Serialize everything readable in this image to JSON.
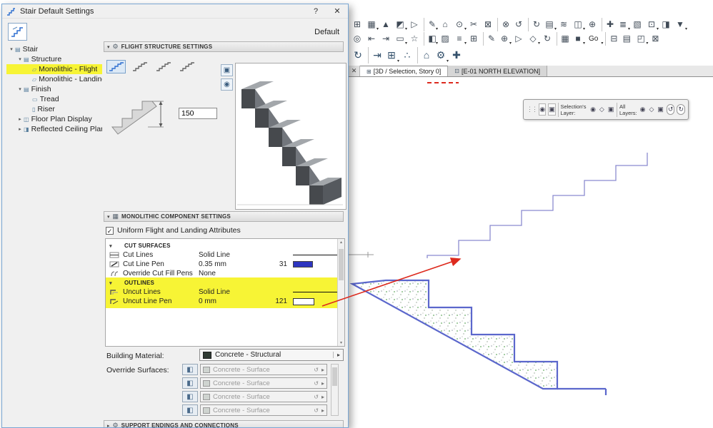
{
  "window": {
    "title": "Stair Default Settings",
    "help_label": "?",
    "close_label": "✕",
    "default_label": "Default"
  },
  "icons": {
    "collapse": "▾",
    "expand": "▸",
    "caret": "▾",
    "check": "✓",
    "display_btn": "▣",
    "orbit_btn": "◉",
    "tab_grid": "⊞",
    "tab_close": "✕",
    "surface_btn": "◧",
    "reset_mini": "↺",
    "dd_arrow": "▸"
  },
  "sidebar": {
    "items": [
      {
        "label": "Stair",
        "arrow": "▾",
        "icon": "▤",
        "indent": 0
      },
      {
        "label": "Structure",
        "arrow": "▾",
        "icon": "▤",
        "indent": 1
      },
      {
        "label": "Monolithic - Flight",
        "arrow": "",
        "icon": "▱",
        "indent": 2,
        "highlight": true
      },
      {
        "label": "Monolithic - Landing",
        "arrow": "",
        "icon": "▱",
        "indent": 2
      },
      {
        "label": "Finish",
        "arrow": "▾",
        "icon": "▤",
        "indent": 1
      },
      {
        "label": "Tread",
        "arrow": "",
        "icon": "▭",
        "indent": 2
      },
      {
        "label": "Riser",
        "arrow": "",
        "icon": "▯",
        "indent": 2
      },
      {
        "label": "Floor Plan Display",
        "arrow": "▸",
        "icon": "◫",
        "indent": 1
      },
      {
        "label": "Reflected Ceiling Plan",
        "arrow": "▸",
        "icon": "◨",
        "indent": 1
      }
    ]
  },
  "flight": {
    "title": "FLIGHT STRUCTURE SETTINGS",
    "input_value": "150",
    "types": [
      {
        "sel": true
      },
      {},
      {},
      {}
    ]
  },
  "mono": {
    "title": "MONOLITHIC COMPONENT SETTINGS",
    "uniform_checkbox": "Uniform Flight and Landing Attributes",
    "cut_header": "CUT SURFACES",
    "cut_rows": [
      {
        "label": "Cut Lines",
        "value": "Solid Line"
      },
      {
        "label": "Cut Line Pen",
        "value": "0.35 mm",
        "pen": "31"
      },
      {
        "label": "Override Cut Fill Pens",
        "value": "None"
      }
    ],
    "outlines_header": "OUTLINES",
    "outline_rows": [
      {
        "label": "Uncut Lines",
        "value": "Solid Line"
      },
      {
        "label": "Uncut Line Pen",
        "value": "0 mm",
        "pen": "121"
      }
    ]
  },
  "material": {
    "label": "Building Material:",
    "value": "Concrete - Structural"
  },
  "surfaces": {
    "label": "Override Surfaces:",
    "rows": [
      "Concrete - Surface",
      "Concrete - Surface",
      "Concrete - Surface",
      "Concrete - Surface"
    ]
  },
  "support": {
    "title": "SUPPORT ENDINGS AND CONNECTIONS"
  },
  "tabs": [
    {
      "icon": "⊞",
      "label": "[3D / Selection, Story 0]",
      "active": true
    },
    {
      "icon": "⊡",
      "label": "[E-01 NORTH ELEVATION]"
    }
  ],
  "layers": {
    "selection_label": "Selection's Layer:",
    "all_label": "All Layers:",
    "eye": "◉",
    "fill": "◇",
    "lock": "▣",
    "undo": "↺",
    "redo": "↻",
    "grip": "⋮⋮"
  },
  "toolbar": {
    "row1": [
      {
        "g": "⊞"
      },
      {
        "g": "▦",
        "d": 1
      },
      {
        "g": "▲"
      },
      {
        "g": "◩",
        "d": 1
      },
      {
        "g": "▷"
      },
      {
        "g": "✎",
        "s": 1,
        "d": 1
      },
      {
        "g": "⌂"
      },
      {
        "g": "⊙",
        "d": 1
      },
      {
        "g": "✂"
      },
      {
        "g": "⊠"
      },
      {
        "g": "⊗",
        "s": 1
      },
      {
        "g": "↺"
      },
      {
        "g": "↻",
        "s": 1
      },
      {
        "g": "▤",
        "d": 1
      },
      {
        "g": "≋"
      },
      {
        "g": "◫",
        "d": 1
      },
      {
        "g": "⊕"
      },
      {
        "g": "✚",
        "s": 1
      },
      {
        "g": "≣",
        "d": 1
      },
      {
        "g": "▧"
      },
      {
        "g": "⊡",
        "d": 1
      },
      {
        "g": "◨"
      },
      {
        "g": "▼",
        "d": 1
      }
    ],
    "row2": [
      {
        "g": "◎"
      },
      {
        "g": "⇤"
      },
      {
        "g": "⇥"
      },
      {
        "g": "▭",
        "d": 1
      },
      {
        "g": "☆"
      },
      {
        "g": "◧",
        "s": 1,
        "d": 1
      },
      {
        "g": "▨"
      },
      {
        "g": "≡",
        "d": 1
      },
      {
        "g": "⊞"
      },
      {
        "g": "✎",
        "s": 1
      },
      {
        "g": "⊕",
        "d": 1
      },
      {
        "g": "▷"
      },
      {
        "g": "◇",
        "d": 1
      },
      {
        "g": "↻"
      },
      {
        "g": "▦",
        "s": 1
      },
      {
        "g": "■",
        "d": 1
      },
      {
        "g": "Go",
        "t": 1,
        "d": 1
      },
      {
        "g": "⊟",
        "s": 1
      },
      {
        "g": "▤"
      },
      {
        "g": "◰",
        "d": 1
      },
      {
        "g": "⊠"
      }
    ],
    "row3": [
      {
        "g": "↻"
      },
      {
        "g": "⇥",
        "s": 1
      },
      {
        "g": "⊞",
        "d": 1
      },
      {
        "g": "∴"
      },
      {
        "g": "⌂",
        "s": 1
      },
      {
        "g": "⚙",
        "d": 1
      },
      {
        "g": "✚"
      }
    ]
  },
  "colors": {
    "pen31": "#2d35c0",
    "pen121": "#ffffff",
    "highlight_yellow": "#f7f435",
    "arrow_red": "#dd2a1e",
    "stair_blue": "#5b67cc"
  }
}
